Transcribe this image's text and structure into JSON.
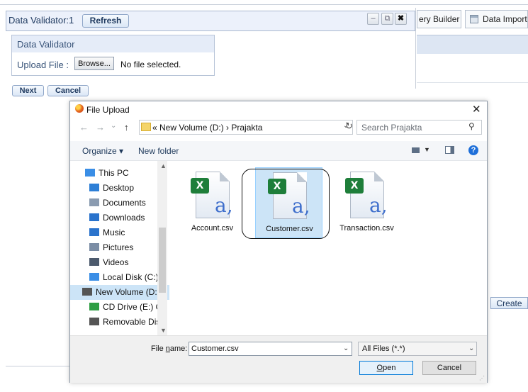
{
  "validator": {
    "title": "Data Validator:1",
    "refresh_label": "Refresh",
    "panel_heading": "Data Validator",
    "upload_label": "Upload File :",
    "browse_label": "Browse...",
    "no_file_text": "No file selected.",
    "next_label": "Next",
    "cancel_label": "Cancel",
    "minimize_glyph": "–",
    "restore_glyph": "⧉",
    "close_glyph": "✖"
  },
  "right_tabs": [
    {
      "label": "ery Builder"
    },
    {
      "label": "Data Import",
      "icon": "table-icon"
    }
  ],
  "create_label": "Create",
  "dialog": {
    "title": "File Upload",
    "close_glyph": "✕",
    "nav": {
      "back": "←",
      "forward": "→",
      "dropdown": "⌄",
      "up": "↑"
    },
    "address": "« New Volume (D:)  ›  Prajakta",
    "search_placeholder": "Search Prajakta",
    "toolbar": {
      "organize": "Organize ▾",
      "new_folder": "New folder",
      "help": "?"
    },
    "tree": [
      {
        "label": "This PC",
        "icon": "computer-icon",
        "color": "#3a8ee6",
        "indent": 0
      },
      {
        "label": "Desktop",
        "icon": "desktop-icon",
        "color": "#2d7fd6",
        "indent": 1
      },
      {
        "label": "Documents",
        "icon": "documents-icon",
        "color": "#8a9bb0",
        "indent": 1
      },
      {
        "label": "Downloads",
        "icon": "downloads-icon",
        "color": "#2a73cc",
        "indent": 1
      },
      {
        "label": "Music",
        "icon": "music-icon",
        "color": "#2a73cc",
        "indent": 1
      },
      {
        "label": "Pictures",
        "icon": "pictures-icon",
        "color": "#7b8da5",
        "indent": 1
      },
      {
        "label": "Videos",
        "icon": "videos-icon",
        "color": "#4c5a6d",
        "indent": 1
      },
      {
        "label": "Local Disk (C:)",
        "icon": "disk-icon",
        "color": "#3a8ee6",
        "indent": 1
      },
      {
        "label": "New Volume (D:",
        "icon": "drive-icon",
        "color": "#555555",
        "indent": 1,
        "selected": true
      },
      {
        "label": "CD Drive (E:) OP",
        "icon": "cd-drive-icon",
        "color": "#2f9e44",
        "indent": 1
      },
      {
        "label": "Removable Disk",
        "icon": "removable-disk-icon",
        "color": "#555555",
        "indent": 1
      }
    ],
    "files": [
      {
        "name": "Account.csv",
        "selected": false
      },
      {
        "name": "Customer.csv",
        "selected": true
      },
      {
        "name": "Transaction.csv",
        "selected": false
      }
    ],
    "file_name_label": "File name:",
    "file_name_value": "Customer.csv",
    "file_type_value": "All Files (*.*)",
    "open_label": "Open",
    "cancel_label": "Cancel",
    "icon_letter": "a,",
    "excel_letter": "X"
  }
}
